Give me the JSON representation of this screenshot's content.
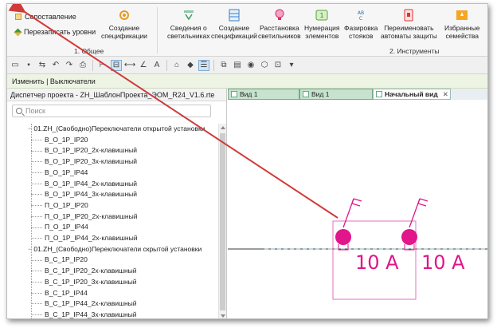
{
  "ribbon": {
    "compare_label": "Сопоставление",
    "rewrite_label": "Перезаписать уровни",
    "create_spec_label_1": "Создание",
    "create_spec_label_2": "спецификации",
    "group1_label": "1. Общее",
    "buttons": [
      {
        "l1": "Сведения о",
        "l2": "светильниках"
      },
      {
        "l1": "Создание",
        "l2": "спецификаций"
      },
      {
        "l1": "Расстановка",
        "l2": "светильников"
      },
      {
        "l1": "Нумерация",
        "l2": "элементов"
      },
      {
        "l1": "Фазировка",
        "l2": "стояков"
      },
      {
        "l1": "Переименовать",
        "l2": "автоматы защиты"
      },
      {
        "l1": "Избранные",
        "l2": "семейства"
      }
    ],
    "group2_label": "2. Инструменты"
  },
  "context_bar": {
    "text": "Изменить | Выключатели"
  },
  "left_panel": {
    "title": "Диспетчер проекта - ZH_ШаблонПроекта_ЭОМ_R24_V1.6.rte",
    "search_placeholder": "Поиск",
    "tree": [
      {
        "type": "group",
        "label": "01.ZH_(Свободно)Переключатели открытой установки"
      },
      {
        "type": "leaf",
        "label": "B_O_1P_IP20"
      },
      {
        "type": "leaf",
        "label": "B_O_1P_IP20_2x-клавишный"
      },
      {
        "type": "leaf",
        "label": "B_O_1P_IP20_3x-клавишный"
      },
      {
        "type": "leaf",
        "label": "B_O_1P_IP44"
      },
      {
        "type": "leaf",
        "label": "B_O_1P_IP44_2x-клавишный"
      },
      {
        "type": "leaf",
        "label": "B_O_1P_IP44_3x-клавишный"
      },
      {
        "type": "leaf",
        "label": "П_O_1P_IP20"
      },
      {
        "type": "leaf",
        "label": "П_O_1P_IP20_2x-клавишный"
      },
      {
        "type": "leaf",
        "label": "П_O_1P_IP44"
      },
      {
        "type": "leaf",
        "label": "П_O_1P_IP44_2x-клавишный"
      },
      {
        "type": "group",
        "label": "01.ZH_(Свободно)Переключатели скрытой установки"
      },
      {
        "type": "leaf",
        "label": "B_C_1P_IP20"
      },
      {
        "type": "leaf",
        "label": "B_C_1P_IP20_2x-клавишный"
      },
      {
        "type": "leaf",
        "label": "B_C_1P_IP20_3x-клавишный"
      },
      {
        "type": "leaf",
        "label": "B_C_1P_IP44"
      },
      {
        "type": "leaf",
        "label": "B_C_1P_IP44_2x-клавишный"
      },
      {
        "type": "leaf",
        "label": "B_C_1P_IP44_3x-клавишный"
      }
    ]
  },
  "tabs": [
    {
      "label": "Вид 1",
      "style": "green"
    },
    {
      "label": "Вид 1",
      "style": "green"
    },
    {
      "label": "Начальный вид",
      "style": "active"
    }
  ],
  "canvas": {
    "label_left": "10 A",
    "label_right": "10 A",
    "accent_color": "#e0168a",
    "arrow_color": "#d03a3a"
  }
}
